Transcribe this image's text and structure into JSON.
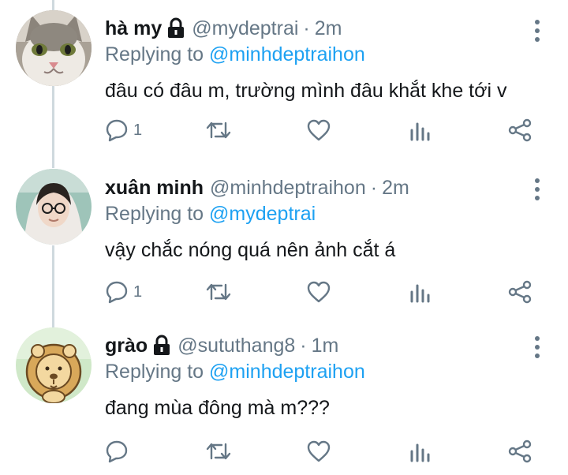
{
  "tweets": [
    {
      "name": "hà my",
      "locked": true,
      "handle": "@mydeptrai",
      "time": "2m",
      "replying_prefix": "Replying to",
      "replying_to": "@minhdeptraihon",
      "text": "đâu có đâu m, trường mình đâu khắt khe tới v",
      "reply_count": "1",
      "avatar": "cat-avatar"
    },
    {
      "name": "xuân minh",
      "locked": false,
      "handle": "@minhdeptraihon",
      "time": "2m",
      "replying_prefix": "Replying to",
      "replying_to": "@mydeptrai",
      "text": "vậy chắc nóng quá nên ảnh cắt á",
      "reply_count": "1",
      "avatar": "person-avatar"
    },
    {
      "name": "grào",
      "locked": true,
      "handle": "@sututhang8",
      "time": "1m",
      "replying_prefix": "Replying to",
      "replying_to": "@minhdeptraihon",
      "text": "đang mùa đông mà m???",
      "reply_count": "",
      "avatar": "lion-avatar"
    }
  ],
  "separator": "·",
  "colors": {
    "link": "#1da1f2",
    "muted": "#657786",
    "thread_line": "#cfd9de"
  }
}
